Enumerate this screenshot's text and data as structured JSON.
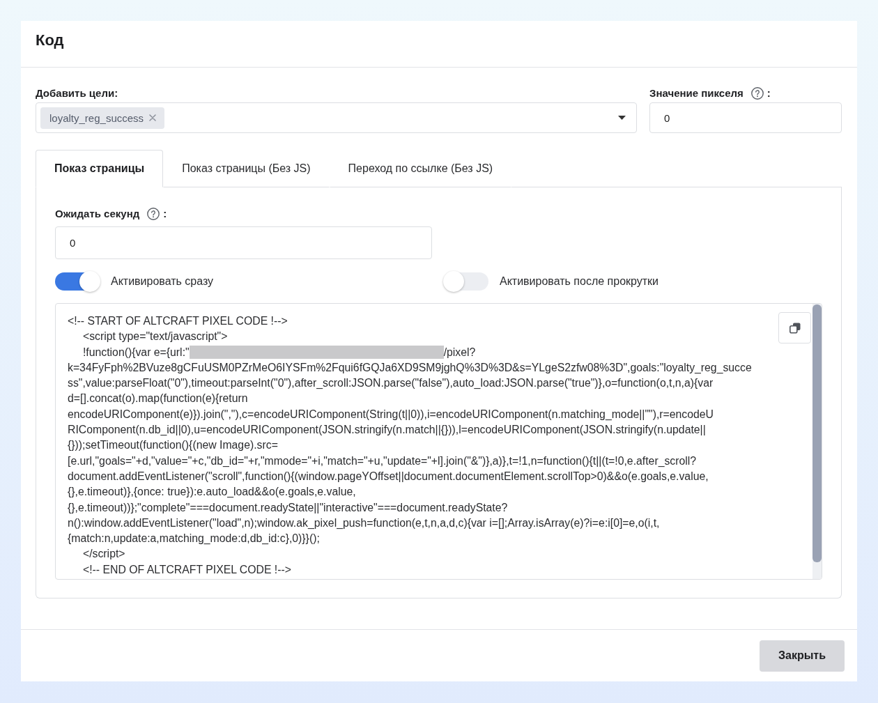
{
  "dialog": {
    "title": "Код"
  },
  "goals": {
    "label": "Добавить цели:",
    "tags": [
      {
        "text": "loyalty_reg_success"
      }
    ]
  },
  "pixel_value": {
    "label": "Значение пикселя",
    "label_suffix": ":",
    "value": "0"
  },
  "tabs": [
    {
      "label": "Показ страницы",
      "selected": true
    },
    {
      "label": "Показ страницы (Без JS)",
      "selected": false
    },
    {
      "label": "Переход по ссылке (Без JS)",
      "selected": false
    }
  ],
  "wait_seconds": {
    "label": "Ожидать секунд",
    "label_suffix": ":",
    "value": "0"
  },
  "toggles": [
    {
      "label": "Активировать сразу",
      "on": true
    },
    {
      "label": "Активировать после прокрутки",
      "on": false
    }
  ],
  "code": {
    "lines": [
      {
        "kind": "text",
        "text": "<!-- START OF ALTCRAFT PIXEL CODE !-->"
      },
      {
        "kind": "text",
        "text": "     <script type=\"text/javascript\">"
      },
      {
        "kind": "redacted",
        "before": "     !function(){var e={url:\"",
        "after": "/pixel?"
      },
      {
        "kind": "text",
        "text": "k=34FyFph%2BVuze8gCFuUSM0PZrMeO6IYSFm%2Fqui6fGQJa6XD9SM9jghQ%3D%3D&s=YLgeS2zfw08%3D\",goals:\"loyalty_reg_succe"
      },
      {
        "kind": "text",
        "text": "ss\",value:parseFloat(\"0\"),timeout:parseInt(\"0\"),after_scroll:JSON.parse(\"false\"),auto_load:JSON.parse(\"true\")},o=function(o,t,n,a){var"
      },
      {
        "kind": "text",
        "text": "d=[].concat(o).map(function(e){return"
      },
      {
        "kind": "text",
        "text": "encodeURIComponent(e)}).join(\",\"),c=encodeURIComponent(String(t||0)),i=encodeURIComponent(n.matching_mode||\"\"),r=encodeU"
      },
      {
        "kind": "text",
        "text": "RIComponent(n.db_id||0),u=encodeURIComponent(JSON.stringify(n.match||{})),l=encodeURIComponent(JSON.stringify(n.update||"
      },
      {
        "kind": "text",
        "text": "{}));setTimeout(function(){(new Image).src="
      },
      {
        "kind": "text",
        "text": "[e.url,\"goals=\"+d,\"value=\"+c,\"db_id=\"+r,\"mmode=\"+i,\"match=\"+u,\"update=\"+l].join(\"&\")},a)},t=!1,n=function(){t||(t=!0,e.after_scroll?"
      },
      {
        "kind": "text",
        "text": "document.addEventListener(\"scroll\",function(){(window.pageYOffset||document.documentElement.scrollTop>0)&&o(e.goals,e.value,"
      },
      {
        "kind": "text",
        "text": "{},e.timeout)},{once: true}):e.auto_load&&o(e.goals,e.value,"
      },
      {
        "kind": "text",
        "text": "{},e.timeout))};\"complete\"===document.readyState||\"interactive\"===document.readyState?"
      },
      {
        "kind": "text",
        "text": "n():window.addEventListener(\"load\",n);window.ak_pixel_push=function(e,t,n,a,d,c){var i=[];Array.isArray(e)?i=e:i[0]=e,o(i,t,"
      },
      {
        "kind": "text",
        "text": "{match:n,update:a,matching_mode:d,db_id:c},0)}}();"
      },
      {
        "kind": "text",
        "text": "     </script>"
      },
      {
        "kind": "text",
        "text": "     <!-- END OF ALTCRAFT PIXEL CODE !-->"
      }
    ]
  },
  "footer": {
    "buttons": [
      {
        "label": "Закрыть"
      }
    ]
  }
}
